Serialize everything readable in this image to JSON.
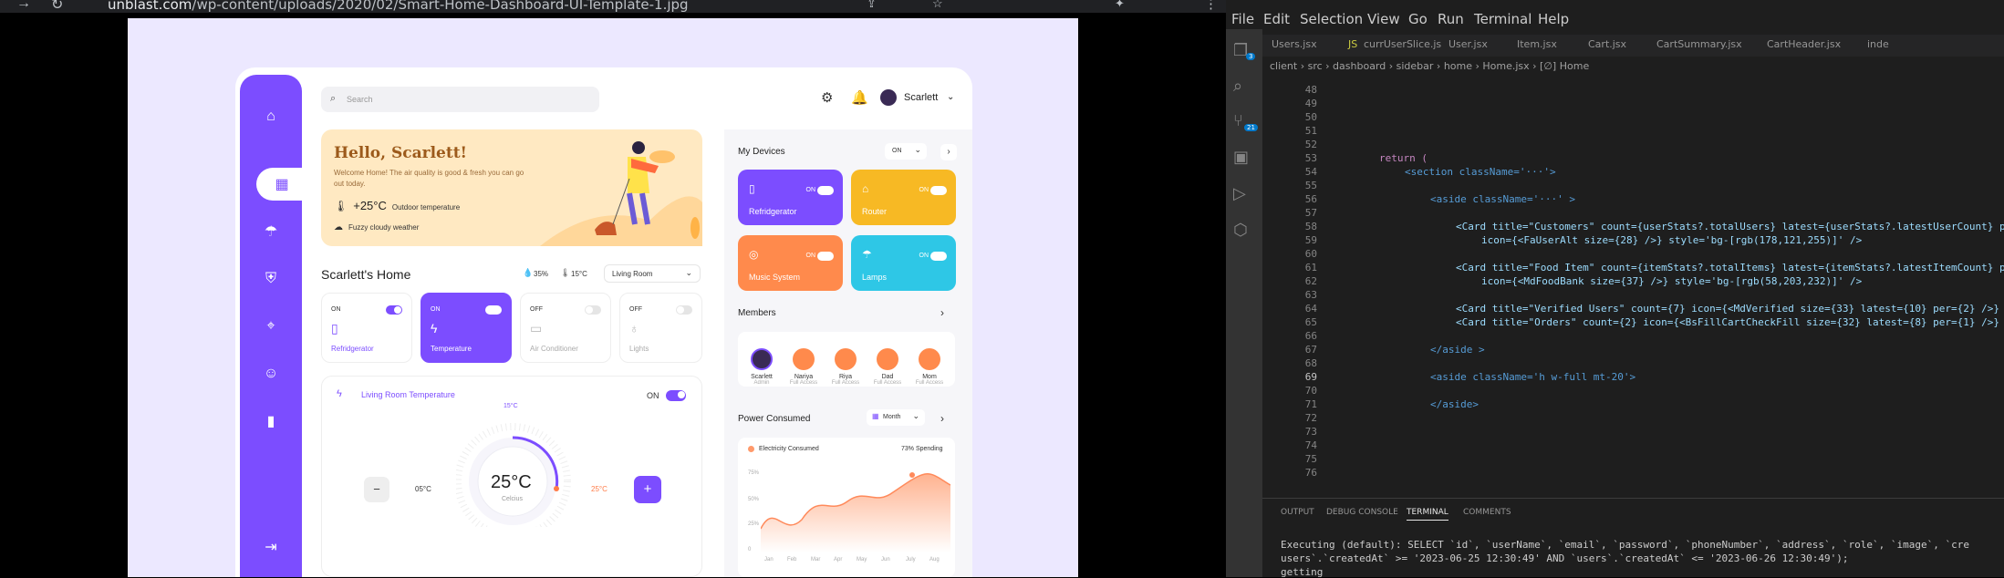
{
  "browser": {
    "url_domain": "unblast.com",
    "url_path": "/wp-content/uploads/2020/02/Smart-Home-Dashboard-UI-Template-1.jpg"
  },
  "dashboard": {
    "search_placeholder": "Search",
    "user_name": "Scarlett",
    "hello_title": "Hello, Scarlett!",
    "hello_text": "Welcome Home! The air quality is good & fresh you can go out today.",
    "outdoor_temp": "+25°C",
    "outdoor_label": "Outdoor temperature",
    "weather": "Fuzzy cloudy weather",
    "home_title": "Scarlett's Home",
    "humidity": "35%",
    "home_temp": "15°C",
    "room_select": "Living Room",
    "cards": [
      {
        "state": "ON",
        "label": "Refridgerator"
      },
      {
        "state": "ON",
        "label": "Temperature"
      },
      {
        "state": "OFF",
        "label": "Air Conditioner"
      },
      {
        "state": "OFF",
        "label": "Lights"
      }
    ],
    "living_temp_title": "Living Room Temperature",
    "living_temp_state": "ON",
    "dial_top": "15°C",
    "dial_value": "25°C",
    "dial_sub": "Celcius",
    "dial_left": "05°C",
    "dial_right": "25°C",
    "minus": "−",
    "plus": "+",
    "my_devices_title": "My Devices",
    "my_devices_filter": "ON",
    "devices": [
      {
        "name": "Refridgerator",
        "state": "ON",
        "color": "#7c4dff"
      },
      {
        "name": "Router",
        "state": "ON",
        "color": "#f7b924"
      },
      {
        "name": "Music System",
        "state": "ON",
        "color": "#ff8a4c"
      },
      {
        "name": "Lamps",
        "state": "ON",
        "color": "#2ec7e6"
      }
    ],
    "members_title": "Members",
    "members": [
      {
        "name": "Scarlett",
        "role": "Admin"
      },
      {
        "name": "Nariya",
        "role": "Full Access"
      },
      {
        "name": "Riya",
        "role": "Full Access"
      },
      {
        "name": "Dad",
        "role": "Full Access"
      },
      {
        "name": "Mom",
        "role": "Full Access"
      }
    ],
    "power_title": "Power Consumed",
    "power_filter": "Month",
    "electricity_label": "Electricity Consumed",
    "spending": "73% Spending",
    "y_ticks": [
      "75%",
      "50%",
      "25%",
      "0"
    ],
    "months": [
      "Jan",
      "Feb",
      "Mar",
      "Apr",
      "May",
      "Jun",
      "July",
      "Aug"
    ]
  },
  "vscode": {
    "menu": [
      "File",
      "Edit",
      "Selection",
      "View",
      "Go",
      "Run",
      "Terminal",
      "Help"
    ],
    "tabs": [
      "Users.jsx",
      "currUserSlice.js",
      "User.jsx",
      "Item.jsx",
      "Cart.jsx",
      "CartSummary.jsx",
      "CartHeader.jsx",
      "inde"
    ],
    "breadcrumb": "client › src › dashboard › sidebar › home › Home.jsx › [∅] Home",
    "activity_badges": [
      "3",
      "21"
    ],
    "line_numbers": [
      "48",
      "49",
      "50",
      "51",
      "52",
      "53",
      "54",
      "55",
      "56",
      "57",
      "58",
      "59",
      "60",
      "61",
      "62",
      "63",
      "64",
      "65",
      "66",
      "67",
      "68",
      "69",
      "70",
      "71",
      "72",
      "73",
      "74",
      "75",
      "76"
    ],
    "code": {
      "l53": "return (",
      "l54": "<section className='···'>",
      "l56": "<aside className='···' >",
      "l58": "<Card title=\"Customers\" count={userStats?.totalUsers} latest={userStats?.latestUserCount} pe",
      "l59": "icon={<FaUserAlt size={28} />} style='bg-[rgb(178,121,255)]' />",
      "l61": "<Card title=\"Food Item\" count={itemStats?.totalItems} latest={itemStats?.latestItemCount} pe",
      "l62": "icon={<MdFoodBank size={37} />} style='bg-[rgb(58,203,232)]' />",
      "l64": "<Card title=\"Verified Users\" count={7} icon={<MdVerified size={33} latest={10} per={2} />} s",
      "l65": "<Card title=\"Orders\" count={2} icon={<BsFillCartCheckFill size={32} latest={8} per={1} />} s",
      "l67": "</aside >",
      "l69": "<aside className='h w-full mt-20'>",
      "l71": "</aside>"
    },
    "panel_tabs": [
      "OUTPUT",
      "DEBUG CONSOLE",
      "TERMINAL",
      "COMMENTS"
    ],
    "terminal": [
      "Executing (default): SELECT `id`, `userName`, `email`, `password`, `phoneNumber`, `address`, `role`, `image`, `cre",
      "users`.`createdAt` >= '2023-06-25 12:30:49' AND `users`.`createdAt` <= '2023-06-26 12:30:49');",
      "getting"
    ]
  }
}
